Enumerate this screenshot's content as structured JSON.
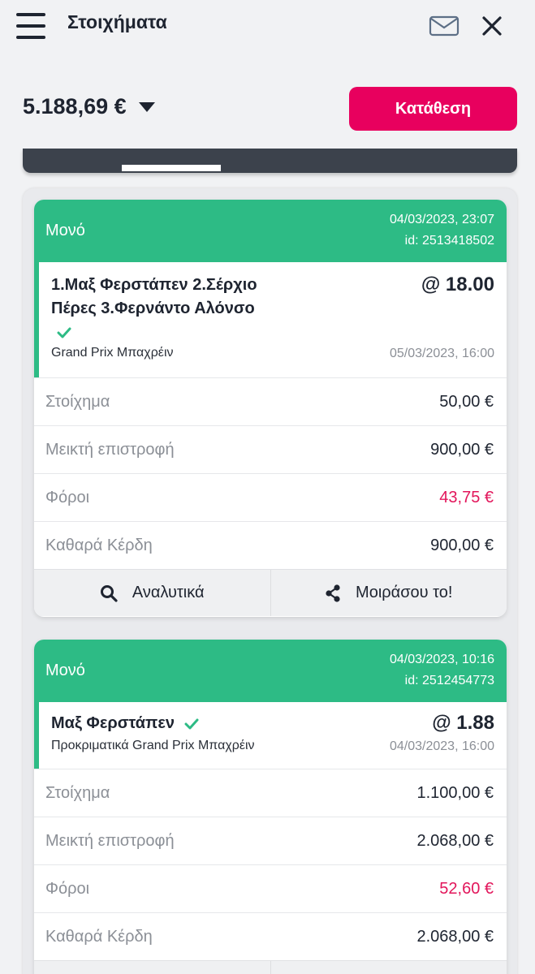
{
  "header": {
    "title": "Στοιχήματα"
  },
  "balance": {
    "amount": "5.188,69 €"
  },
  "deposit": {
    "label": "Κατάθεση"
  },
  "bets": [
    {
      "type": "Μονό",
      "date": "04/03/2023, 23:07",
      "id": "id: 2513418502",
      "selection": {
        "line1": "1.Μαξ Φερστάπεν 2.Σέρχιο",
        "line2": "Πέρες 3.Φερνάντο Αλόνσο",
        "odds": "@ 18.00",
        "event": "Grand Prix Μπαχρέιν",
        "event_date": "05/03/2023, 16:00"
      },
      "rows": [
        {
          "label": "Στοίχημα",
          "value": "50,00 €"
        },
        {
          "label": "Μεικτή επιστροφή",
          "value": "900,00 €"
        },
        {
          "label": "Φόροι",
          "value": "43,75 €"
        },
        {
          "label": "Καθαρά Κέρδη",
          "value": "900,00 €"
        }
      ],
      "actions": {
        "details": "Αναλυτικά",
        "share": "Μοιράσου το!"
      }
    },
    {
      "type": "Μονό",
      "date": "04/03/2023, 10:16",
      "id": "id: 2512454773",
      "selection": {
        "line1": "Μαξ Φερστάπεν",
        "odds": "@ 1.88",
        "event": "Προκριματικά Grand Prix Μπαχρέιν",
        "event_date": "04/03/2023, 16:00"
      },
      "rows": [
        {
          "label": "Στοίχημα",
          "value": "1.100,00 €"
        },
        {
          "label": "Μεικτή επιστροφή",
          "value": "2.068,00 €"
        },
        {
          "label": "Φόροι",
          "value": "52,60 €"
        },
        {
          "label": "Καθαρά Κέρδη",
          "value": "2.068,00 €"
        }
      ]
    }
  ],
  "colors": {
    "accent_green": "#2dbb85",
    "brand_pink": "#e8005e",
    "tax_red": "#e2165b",
    "tab_dark": "#3c424c"
  },
  "icons": [
    "menu-icon",
    "mail-icon",
    "close-icon",
    "dropdown-caret-icon",
    "check-icon",
    "search-icon",
    "share-icon"
  ]
}
